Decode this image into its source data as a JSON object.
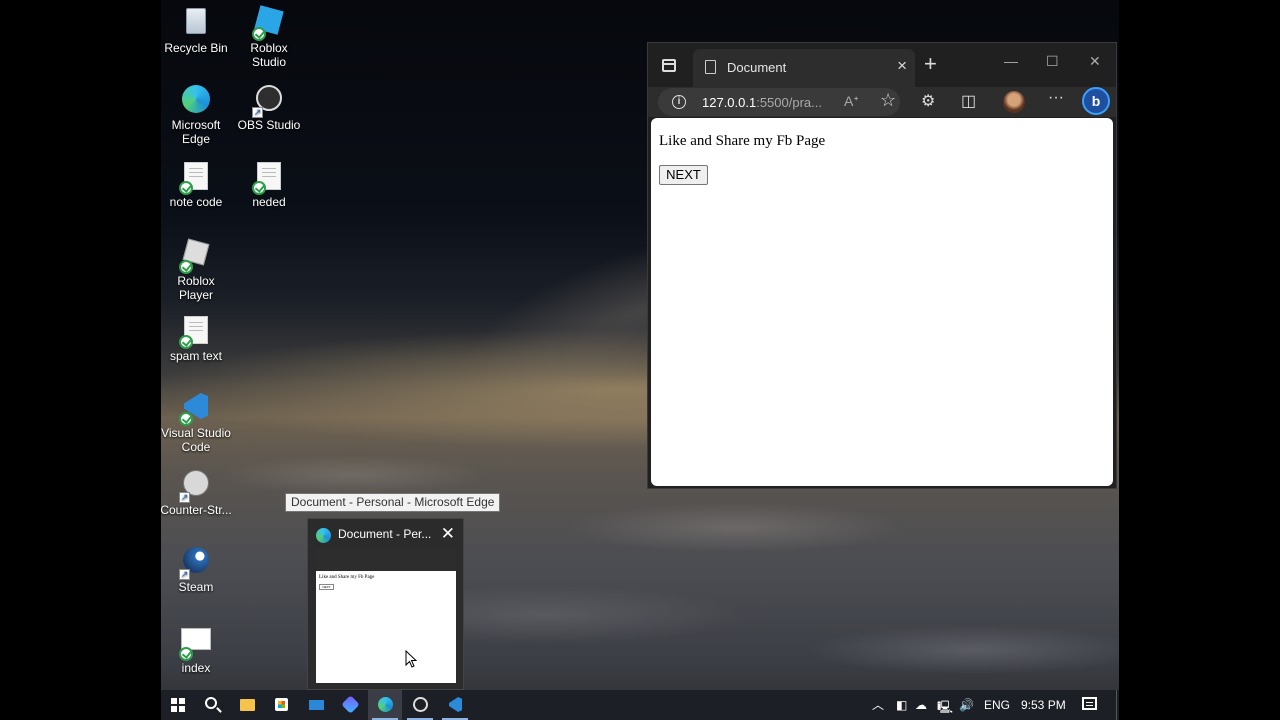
{
  "desktop": {
    "icons": [
      {
        "label": "Recycle Bin",
        "icon": "recycle-bin-icon"
      },
      {
        "label": "Roblox Studio",
        "icon": "roblox-studio-icon"
      },
      {
        "label": "Microsoft Edge",
        "icon": "edge-icon"
      },
      {
        "label": "OBS Studio",
        "icon": "obs-icon"
      },
      {
        "label": "note code",
        "icon": "text-file-icon"
      },
      {
        "label": "neded",
        "icon": "text-file-icon"
      },
      {
        "label": "Roblox Player",
        "icon": "roblox-player-icon"
      },
      {
        "label": "spam text",
        "icon": "text-file-icon"
      },
      {
        "label": "Visual Studio Code",
        "icon": "vscode-icon"
      },
      {
        "label": "Counter-Str...",
        "icon": "counter-strike-icon"
      },
      {
        "label": "Steam",
        "icon": "steam-icon"
      },
      {
        "label": "index",
        "icon": "html-file-icon"
      }
    ]
  },
  "browser": {
    "tab_title": "Document",
    "url_host": "127.0.0.1",
    "url_rest": ":5500/pra...",
    "page_text": "Like and Share my Fb Page",
    "button_label": "NEXT"
  },
  "tooltip": "Document - Personal - Microsoft Edge",
  "preview": {
    "title": "Document - Per...",
    "mini_text": "Like and Share my Fb Page",
    "mini_button": "NEXT"
  },
  "taskbar": {
    "items": [
      "start",
      "search",
      "file-explorer",
      "store",
      "mail",
      "copilot",
      "edge",
      "obs",
      "vscode"
    ],
    "language": "ENG",
    "time": "9:53 PM"
  }
}
